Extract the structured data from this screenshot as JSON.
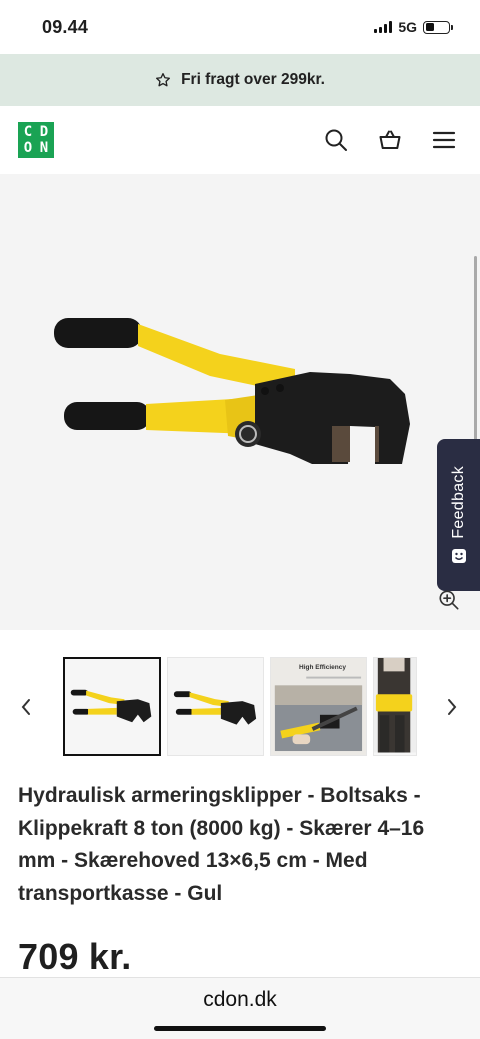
{
  "status_bar": {
    "time": "09.44",
    "network": "5G"
  },
  "promo": {
    "text": "Fri fragt over 299kr.",
    "icon": "star-icon"
  },
  "header": {
    "logo_letters": [
      "C",
      "D",
      "O",
      "N"
    ],
    "logo_color": "#1aa354",
    "icons": [
      "search-icon",
      "basket-icon",
      "menu-icon"
    ]
  },
  "gallery": {
    "feedback_label": "Feedback",
    "thumbnail_count": 4,
    "active_thumbnail": 1,
    "thumb3_heading": "High Efficiency"
  },
  "product": {
    "title": "Hydraulisk armeringsklipper - Boltsaks - Klippekraft 8 ton (8000 kg) - Skærer 4–16 mm - Skærehoved 13×6,5 cm - Med transportkasse - Gul",
    "price": "709 kr."
  },
  "browser": {
    "url": "cdon.dk"
  },
  "colors": {
    "promo_bg": "#dde8e1",
    "accent_yellow": "#f4d21c",
    "feedback_bg": "#2a2d43"
  }
}
